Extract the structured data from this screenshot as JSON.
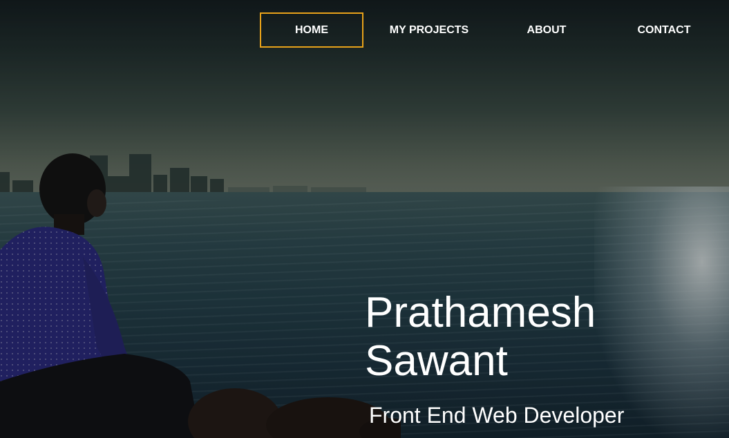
{
  "nav": {
    "items": [
      {
        "label": "HOME",
        "active": true
      },
      {
        "label": "MY PROJECTS",
        "active": false
      },
      {
        "label": "ABOUT",
        "active": false
      },
      {
        "label": "CONTACT",
        "active": false
      }
    ],
    "active_border_color": "#e8a21a"
  },
  "hero": {
    "first_name": "Prathamesh",
    "last_name": "Sawant",
    "subtitle": "Front End Web Developer",
    "background_image": "person-sitting-by-sea-with-city-skyline"
  }
}
